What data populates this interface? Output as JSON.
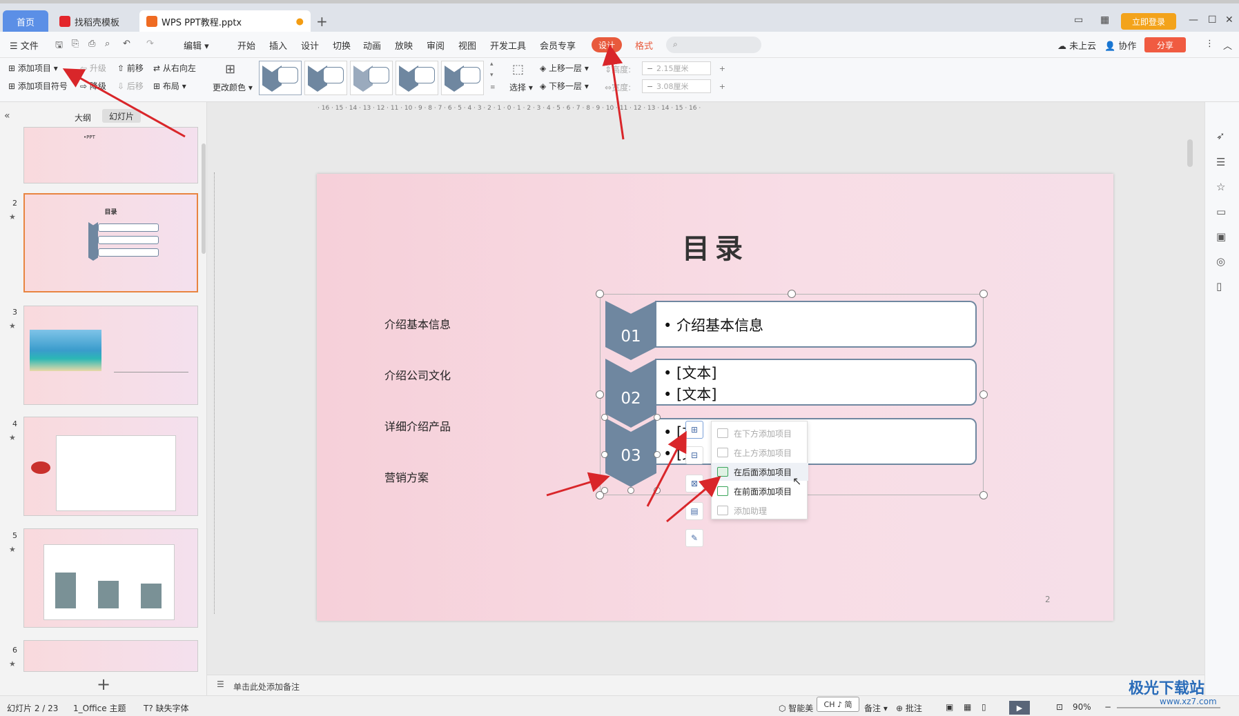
{
  "titlebar": {
    "tab_home": "首页",
    "tab_templates": "找稻壳模板",
    "tab_doc": "WPS PPT教程.pptx",
    "login": "立即登录"
  },
  "menubar": {
    "file": "文件",
    "edit": "编辑",
    "items": [
      "开始",
      "插入",
      "设计",
      "切换",
      "动画",
      "放映",
      "审阅",
      "视图",
      "开发工具",
      "会员专享"
    ],
    "design_tab": "设计",
    "format_tab": "格式",
    "cloud": "未上云",
    "collab": "协作",
    "share": "分享"
  },
  "ribbon": {
    "add_item": "添加项目",
    "add_bullet": "添加项目符号",
    "promote": "升级",
    "demote": "降级",
    "move_forward": "前移",
    "move_back": "后移",
    "right_to_left": "从右向左",
    "layout": "布局",
    "change_color": "更改颜色",
    "select": "选择",
    "bring_forward": "上移一层",
    "send_backward": "下移一层",
    "height_label": "高度:",
    "height_value": "2.15厘米",
    "width_label": "宽度:",
    "width_value": "3.08厘米"
  },
  "leftpanel": {
    "tab_outline": "大纲",
    "tab_slides": "幻灯片",
    "thumb1_text": "•PPT",
    "thumb2_title": "目录",
    "thumb_numbers": [
      "2",
      "3",
      "4",
      "5",
      "6"
    ]
  },
  "slide": {
    "title": "目录",
    "left_labels": [
      "介绍基本信息",
      "介绍公司文化",
      "详细介绍产品",
      "营销方案"
    ],
    "chevrons": [
      "01",
      "02",
      "03"
    ],
    "box1": "• 介绍基本信息",
    "box2_line1": "• [文本]",
    "box2_line2": "• [文本]",
    "box3_line1": "• [文",
    "box3_line2": "• [文",
    "page_number": "2"
  },
  "context_menu": {
    "items": [
      "在下方添加项目",
      "在上方添加项目",
      "在后面添加项目",
      "在前面添加项目",
      "添加助理"
    ]
  },
  "notes": {
    "placeholder": "单击此处添加备注"
  },
  "status": {
    "slide_info": "幻灯片 2 / 23",
    "theme": "1_Office 主题",
    "missing_font": "缺失字体",
    "smart": "智能美",
    "ime": "CH ♪ 简",
    "notes": "备注",
    "comments": "批注",
    "zoom": "90%"
  },
  "watermark": {
    "name": "极光下载站",
    "url": "www.xz7.com"
  },
  "colors": {
    "accent": "#e85a3c",
    "chevron": "#6f87a0",
    "home_tab": "#5b8fe6",
    "arrow": "#d9262a"
  }
}
